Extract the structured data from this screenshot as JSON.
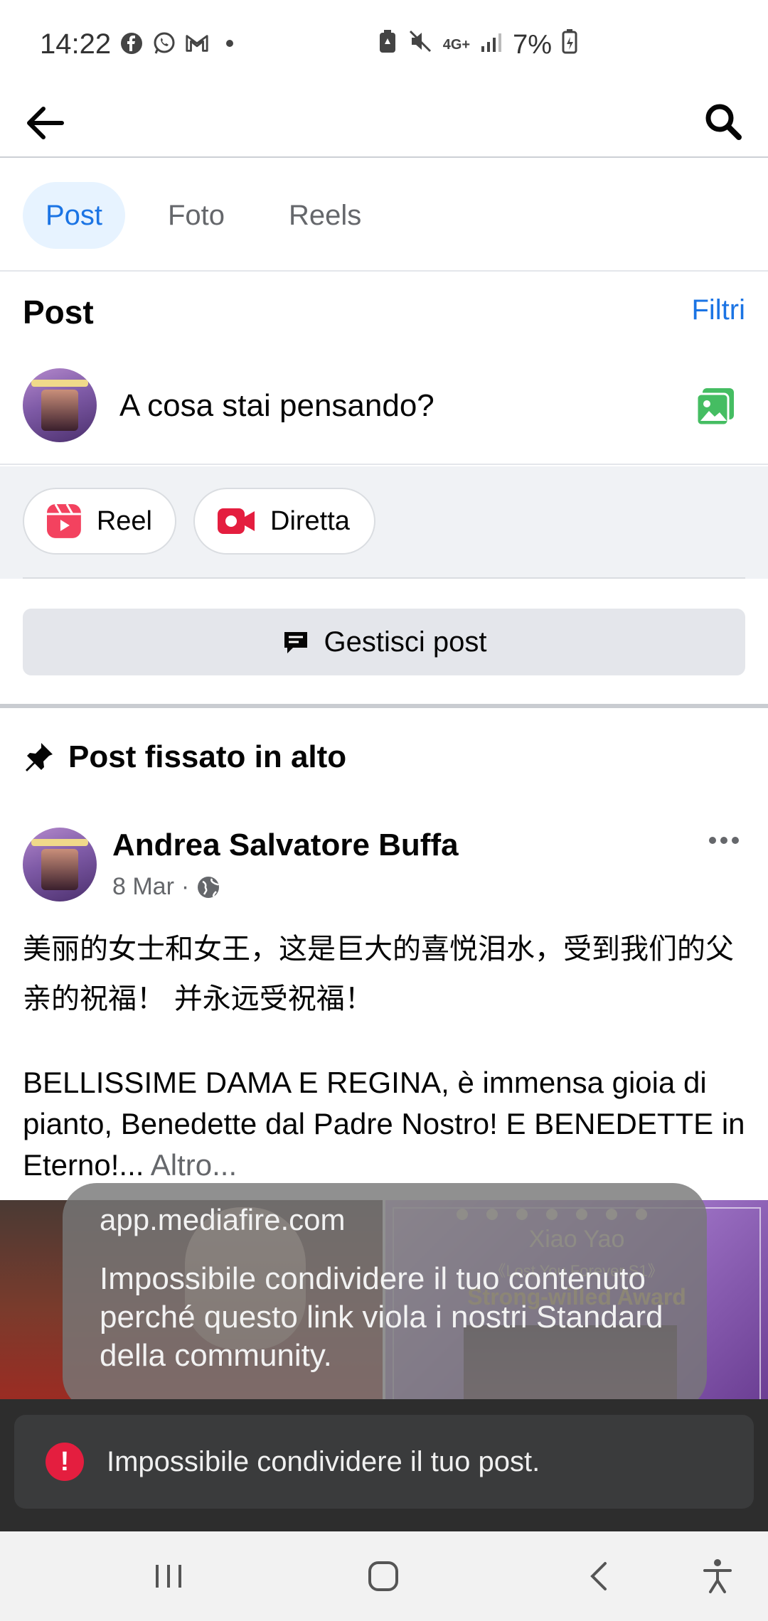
{
  "status_bar": {
    "time": "14:22",
    "network": "4G+",
    "battery": "7%",
    "left_icons": [
      "facebook-icon",
      "whatsapp-icon",
      "gmail-icon",
      "dot-icon"
    ],
    "right_icons": [
      "battery-saver-icon",
      "mute-icon",
      "network-icon",
      "signal-icon",
      "battery-icon"
    ]
  },
  "tabs": [
    {
      "label": "Post",
      "active": true
    },
    {
      "label": "Foto",
      "active": false
    },
    {
      "label": "Reels",
      "active": false
    }
  ],
  "section": {
    "title": "Post",
    "filter_label": "Filtri"
  },
  "composer": {
    "placeholder": "A cosa stai pensando?"
  },
  "quick_actions": {
    "reel_label": "Reel",
    "live_label": "Diretta"
  },
  "manage": {
    "label": "Gestisci post"
  },
  "pinned": {
    "label": "Post fissato in alto"
  },
  "post": {
    "author": "Andrea Salvatore Buffa",
    "date": "8 Mar",
    "separator": "·",
    "text_cn": "美丽的女士和女王，这是巨大的喜悦泪水，受到我们的父亲的祝福！ 并永远受祝福！",
    "text_it": "BELLISSIME DAMA E REGINA, è immensa gioia di pianto, Benedette dal Padre Nostro! E BENEDETTE in Eterno!...",
    "more": "Altro...",
    "image_title": "Xiao Yao",
    "image_subtitle": "《Lost You Forever S1》",
    "image_award": "Strong-willed Award"
  },
  "toast": {
    "domain": "app.mediafire.com",
    "message": "Impossibile condividere il tuo contenuto perché questo link viola i nostri Standard della community."
  },
  "snackbar": {
    "message": "Impossibile condividere il tuo post."
  },
  "colors": {
    "accent": "#1b74e4",
    "error": "#e41e3f",
    "photo_green": "#45bd62",
    "reel_pink": "#f3425f"
  }
}
